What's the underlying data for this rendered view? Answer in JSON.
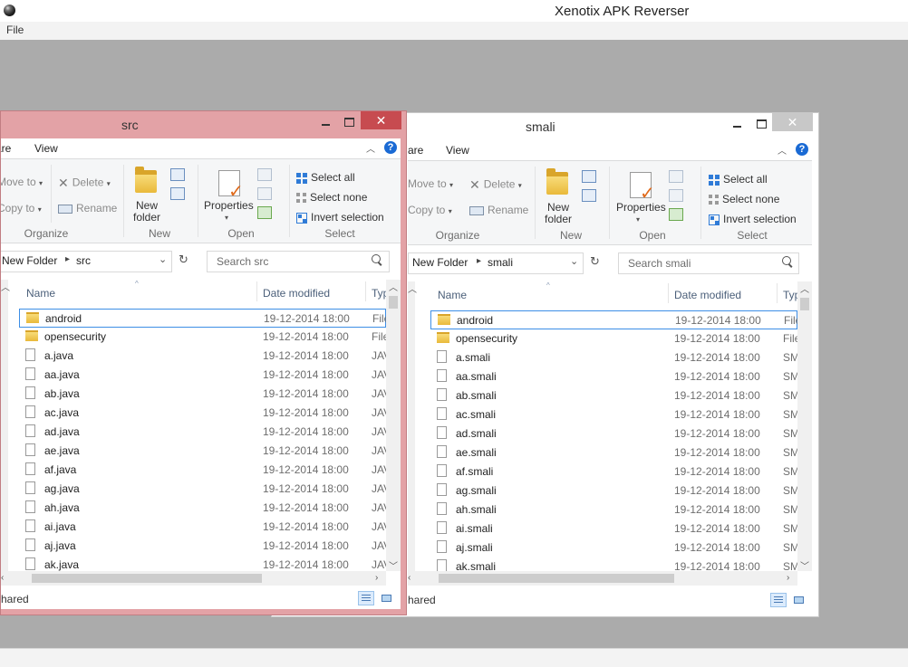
{
  "app": {
    "title": "Xenotix APK Reverser",
    "menu_file": "File"
  },
  "ribbon": {
    "tab_share": "are",
    "tab_view": "View",
    "move_to": "Move to",
    "copy_to": "Copy to",
    "delete": "Delete",
    "rename": "Rename",
    "new_folder_line1": "New",
    "new_folder_line2": "folder",
    "properties": "Properties",
    "select_all": "Select all",
    "select_none": "Select none",
    "invert_selection": "Invert selection",
    "grp_organize": "Organize",
    "grp_new": "New",
    "grp_open": "Open",
    "grp_select": "Select",
    "help": "?"
  },
  "columns": {
    "name": "Name",
    "date": "Date modified",
    "type": "Typ"
  },
  "src": {
    "title": "src",
    "path_parent": "New Folder",
    "path_current": "src",
    "search_placeholder": "Search src",
    "status": "hared",
    "rows": [
      {
        "name": "android",
        "date": "19-12-2014 18:00",
        "type": "File",
        "kind": "folder"
      },
      {
        "name": "opensecurity",
        "date": "19-12-2014 18:00",
        "type": "File",
        "kind": "folder"
      },
      {
        "name": "a.java",
        "date": "19-12-2014 18:00",
        "type": "JAV",
        "kind": "file"
      },
      {
        "name": "aa.java",
        "date": "19-12-2014 18:00",
        "type": "JAV",
        "kind": "file"
      },
      {
        "name": "ab.java",
        "date": "19-12-2014 18:00",
        "type": "JAV",
        "kind": "file"
      },
      {
        "name": "ac.java",
        "date": "19-12-2014 18:00",
        "type": "JAV",
        "kind": "file"
      },
      {
        "name": "ad.java",
        "date": "19-12-2014 18:00",
        "type": "JAV",
        "kind": "file"
      },
      {
        "name": "ae.java",
        "date": "19-12-2014 18:00",
        "type": "JAV",
        "kind": "file"
      },
      {
        "name": "af.java",
        "date": "19-12-2014 18:00",
        "type": "JAV",
        "kind": "file"
      },
      {
        "name": "ag.java",
        "date": "19-12-2014 18:00",
        "type": "JAV",
        "kind": "file"
      },
      {
        "name": "ah.java",
        "date": "19-12-2014 18:00",
        "type": "JAV",
        "kind": "file"
      },
      {
        "name": "ai.java",
        "date": "19-12-2014 18:00",
        "type": "JAV",
        "kind": "file"
      },
      {
        "name": "aj.java",
        "date": "19-12-2014 18:00",
        "type": "JAV",
        "kind": "file"
      },
      {
        "name": "ak.java",
        "date": "19-12-2014 18:00",
        "type": "JAV",
        "kind": "file"
      }
    ]
  },
  "smali": {
    "title": "smali",
    "path_parent": "New Folder",
    "path_current": "smali",
    "search_placeholder": "Search smali",
    "status": "hared",
    "rows": [
      {
        "name": "android",
        "date": "19-12-2014 18:00",
        "type": "File",
        "kind": "folder"
      },
      {
        "name": "opensecurity",
        "date": "19-12-2014 18:00",
        "type": "File",
        "kind": "folder"
      },
      {
        "name": "a.smali",
        "date": "19-12-2014 18:00",
        "type": "SM",
        "kind": "file"
      },
      {
        "name": "aa.smali",
        "date": "19-12-2014 18:00",
        "type": "SM",
        "kind": "file"
      },
      {
        "name": "ab.smali",
        "date": "19-12-2014 18:00",
        "type": "SM",
        "kind": "file"
      },
      {
        "name": "ac.smali",
        "date": "19-12-2014 18:00",
        "type": "SM",
        "kind": "file"
      },
      {
        "name": "ad.smali",
        "date": "19-12-2014 18:00",
        "type": "SM",
        "kind": "file"
      },
      {
        "name": "ae.smali",
        "date": "19-12-2014 18:00",
        "type": "SM",
        "kind": "file"
      },
      {
        "name": "af.smali",
        "date": "19-12-2014 18:00",
        "type": "SM",
        "kind": "file"
      },
      {
        "name": "ag.smali",
        "date": "19-12-2014 18:00",
        "type": "SM",
        "kind": "file"
      },
      {
        "name": "ah.smali",
        "date": "19-12-2014 18:00",
        "type": "SM",
        "kind": "file"
      },
      {
        "name": "ai.smali",
        "date": "19-12-2014 18:00",
        "type": "SM",
        "kind": "file"
      },
      {
        "name": "aj.smali",
        "date": "19-12-2014 18:00",
        "type": "SM",
        "kind": "file"
      },
      {
        "name": "ak.smali",
        "date": "19-12-2014 18:00",
        "type": "SM",
        "kind": "file"
      }
    ]
  },
  "colors": {
    "active_frame": "#e3a2a6",
    "inactive_frame": "#ffffff",
    "close_active": "#c74b50",
    "accent": "#2f7bd7"
  }
}
